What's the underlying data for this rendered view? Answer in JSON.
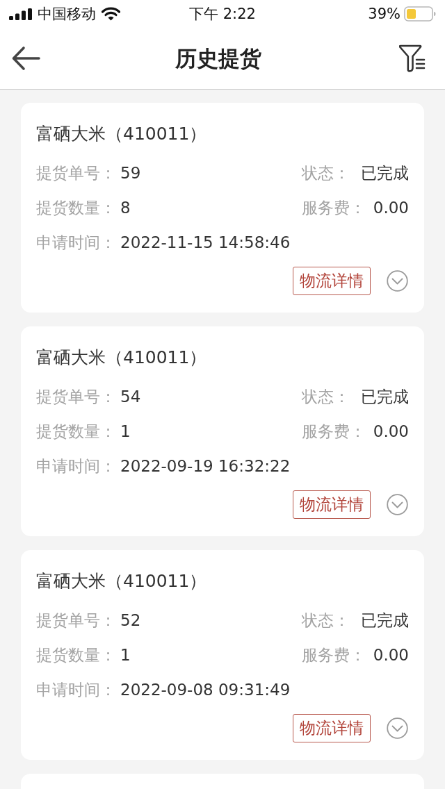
{
  "status_bar": {
    "carrier": "中国移动",
    "time": "下午 2:22",
    "battery": "39%"
  },
  "header": {
    "title": "历史提货"
  },
  "orders": [
    {
      "title": "富硒大米（410011）",
      "rows": [
        {
          "fields": [
            {
              "label": "提货单号：",
              "value": "59"
            },
            {
              "label": "状态：",
              "value": "已完成"
            }
          ]
        },
        {
          "fields": [
            {
              "label": "提货数量：",
              "value": "8"
            },
            {
              "label": "服务费：",
              "value": "0.00"
            }
          ]
        },
        {
          "fields": [
            {
              "label": "申请时间：",
              "value": "2022-11-15 14:58:46"
            }
          ]
        }
      ],
      "button": "物流详情",
      "expanded": false
    },
    {
      "title": "富硒大米（410011）",
      "rows": [
        {
          "fields": [
            {
              "label": "提货单号：",
              "value": "54"
            },
            {
              "label": "状态：",
              "value": "已完成"
            }
          ]
        },
        {
          "fields": [
            {
              "label": "提货数量：",
              "value": "1"
            },
            {
              "label": "服务费：",
              "value": "0.00"
            }
          ]
        },
        {
          "fields": [
            {
              "label": "申请时间：",
              "value": "2022-09-19 16:32:22"
            }
          ]
        }
      ],
      "button": "物流详情",
      "expanded": false
    },
    {
      "title": "富硒大米（410011）",
      "rows": [
        {
          "fields": [
            {
              "label": "提货单号：",
              "value": "52"
            },
            {
              "label": "状态：",
              "value": "已完成"
            }
          ]
        },
        {
          "fields": [
            {
              "label": "提货数量：",
              "value": "1"
            },
            {
              "label": "服务费：",
              "value": "0.00"
            }
          ]
        },
        {
          "fields": [
            {
              "label": "申请时间：",
              "value": "2022-09-08 09:31:49"
            }
          ]
        }
      ],
      "button": "物流详情",
      "expanded": false
    }
  ]
}
